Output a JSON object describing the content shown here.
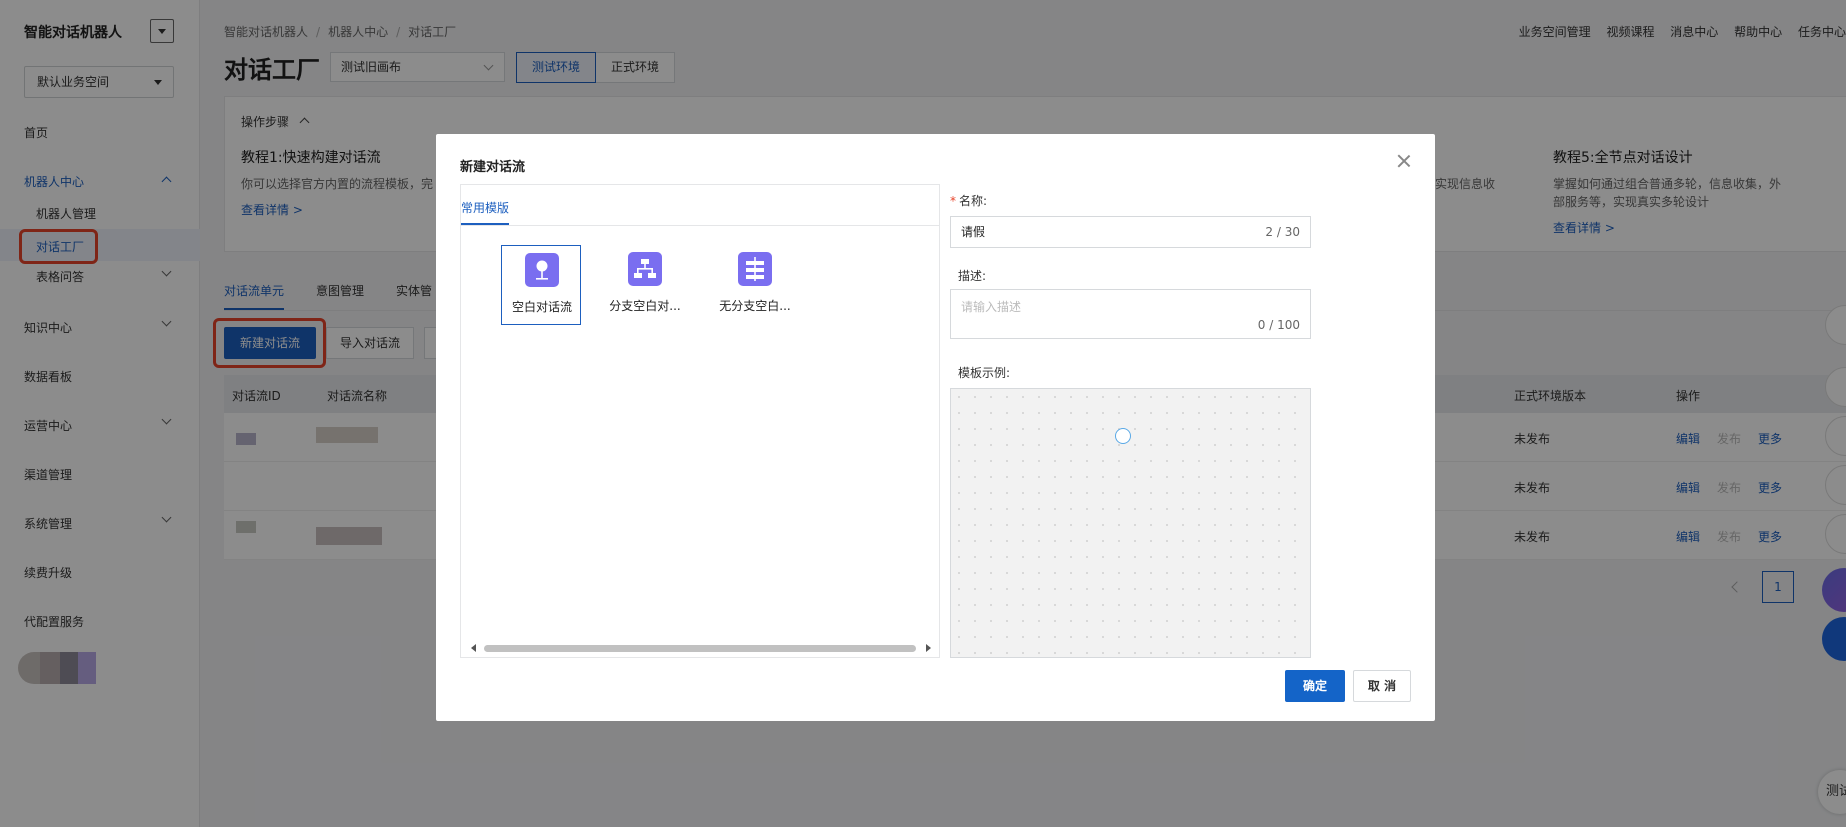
{
  "app": {
    "title": "智能对话机器人"
  },
  "sidebar": {
    "workspace": "默认业务空间",
    "items": [
      {
        "label": "首页"
      },
      {
        "label": "机器人中心"
      },
      {
        "label": "机器人管理"
      },
      {
        "label": "对话工厂"
      },
      {
        "label": "表格问答"
      },
      {
        "label": "知识中心"
      },
      {
        "label": "数据看板"
      },
      {
        "label": "运营中心"
      },
      {
        "label": "渠道管理"
      },
      {
        "label": "系统管理"
      },
      {
        "label": "续费升级"
      },
      {
        "label": "代配置服务"
      }
    ]
  },
  "breadcrumb": [
    "智能对话机器人",
    "/",
    "机器人中心",
    "/",
    "对话工厂"
  ],
  "header": {
    "title": "对话工厂",
    "version_select": "测试旧画布",
    "env_test": "测试环境",
    "env_prod": "正式环境",
    "links": [
      "业务空间管理",
      "视频课程",
      "消息中心",
      "帮助中心",
      "任务中心"
    ]
  },
  "tutorial": {
    "heading": "操作步骤",
    "cards": [
      {
        "title": "教程1:快速构建对话流",
        "desc": "你可以选择官方内置的流程模板，完",
        "link": "查看详情 >"
      },
      {
        "title": "",
        "desc": "实现信息收",
        "link": ""
      },
      {
        "title": "教程5:全节点对话设计",
        "desc": "掌握如何通过组合普通多轮，信息收集，外部服务等，实现真实多轮设计",
        "link": "查看详情 >"
      }
    ]
  },
  "tabs": [
    "对话流单元",
    "意图管理",
    "实体管"
  ],
  "actions": {
    "new_flow": "新建对话流",
    "import_flow": "导入对话流"
  },
  "table": {
    "headers": {
      "id": "对话流ID",
      "name": "对话流名称",
      "prod_version": "正式环境版本",
      "ops": "操作"
    },
    "rows": [
      {
        "prod_version": "未发布",
        "edit": "编辑",
        "publish": "发布",
        "more": "更多"
      },
      {
        "prod_version": "未发布",
        "edit": "编辑",
        "publish": "发布",
        "more": "更多"
      },
      {
        "prod_version": "未发布",
        "edit": "编辑",
        "publish": "发布",
        "more": "更多"
      }
    ]
  },
  "pagination": {
    "current": "1"
  },
  "floating": {
    "test_label": "测试"
  },
  "modal": {
    "title": "新建对话流",
    "tab": "常用模版",
    "templates": [
      {
        "label": "空白对话流",
        "icon": "location-pin-icon"
      },
      {
        "label": "分支空白对...",
        "icon": "branch-tree-icon"
      },
      {
        "label": "无分支空白...",
        "icon": "linear-flow-icon"
      }
    ],
    "name_label": "名称:",
    "name_value": "请假",
    "name_count": "2 / 30",
    "desc_label": "描述:",
    "desc_placeholder": "请输入描述",
    "desc_count": "0 / 100",
    "preview_label": "模板示例:",
    "ok": "确定",
    "cancel": "取 消"
  },
  "colors": {
    "primary": "#1d5fbf",
    "highlight": "#e8442a",
    "template_icon": "#7a6ef0"
  }
}
